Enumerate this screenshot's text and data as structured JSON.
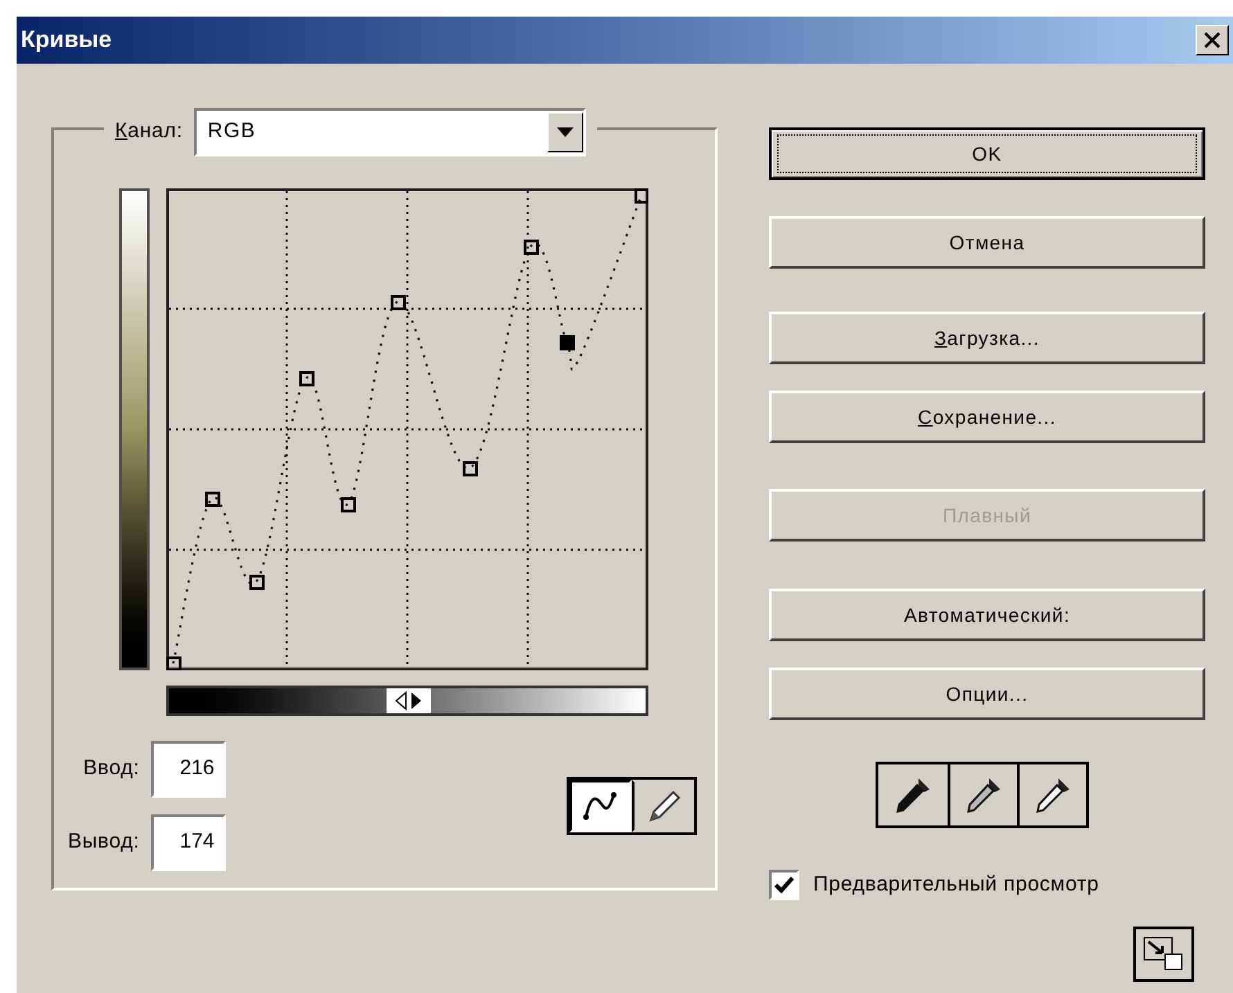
{
  "window": {
    "title": "Кривые"
  },
  "channel": {
    "label": "Канал:",
    "underline_first": true,
    "value": "RGB"
  },
  "input": {
    "label": "Ввод:",
    "value": "216"
  },
  "output": {
    "label": "Вывод:",
    "value": "174"
  },
  "curve_tools": [
    {
      "kind": "curve",
      "selected": true
    },
    {
      "kind": "pencil",
      "selected": false
    }
  ],
  "buttons": [
    {
      "label": "OK",
      "default": true,
      "disabled": false,
      "underline_first": false
    },
    {
      "label": "Отмена",
      "default": false,
      "disabled": false,
      "underline_first": false
    },
    {
      "label": "Загрузка...",
      "default": false,
      "disabled": false,
      "underline_first": true
    },
    {
      "label": "Сохранение...",
      "default": false,
      "disabled": false,
      "underline_first": true
    },
    {
      "label": "Плавный",
      "default": false,
      "disabled": true,
      "underline_first": false
    },
    {
      "label": "Автоматический:",
      "default": false,
      "disabled": false,
      "underline_first": false
    },
    {
      "label": "Опции...",
      "default": false,
      "disabled": false,
      "underline_first": false
    }
  ],
  "eyedroppers": [
    {
      "kind": "black"
    },
    {
      "kind": "gray"
    },
    {
      "kind": "white"
    }
  ],
  "preview": {
    "label": "Предварительный просмотр",
    "checked": true
  }
}
